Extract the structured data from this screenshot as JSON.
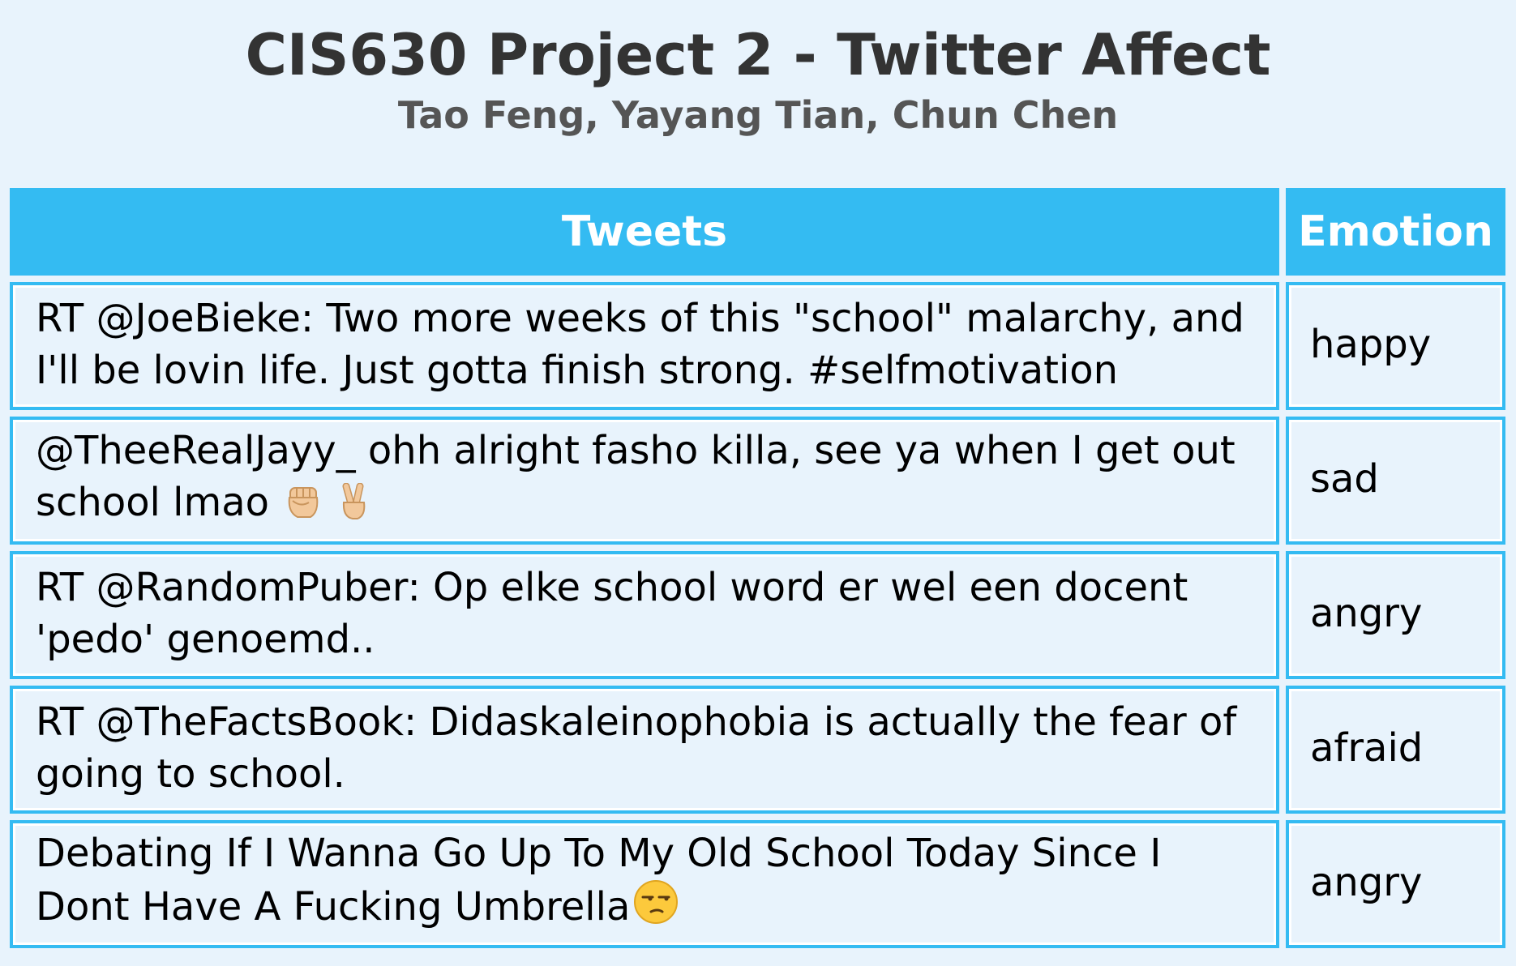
{
  "header": {
    "title": "CIS630 Project 2 - Twitter Affect",
    "subtitle": "Tao Feng, Yayang Tian, Chun Chen"
  },
  "table": {
    "columns": [
      "Tweets",
      "Emotion"
    ],
    "rows": [
      {
        "tweet": "RT @JoeBieke: Two more weeks of this \"school\" malarchy, and I'll be lovin life. Just gotta finish strong. #selfmotivation",
        "emotion": "happy"
      },
      {
        "tweet": "@TheeRealJayy_ ohh alright fasho killa, see ya when I get out school lmao",
        "emoji": [
          "raised-fist-icon",
          "victory-hand-icon"
        ],
        "emotion": "sad"
      },
      {
        "tweet": "RT @RandomPuber: Op elke school word er wel een docent 'pedo' genoemd..",
        "emotion": "angry"
      },
      {
        "tweet": "RT @TheFactsBook: Didaskaleinophobia is actually the fear of going to school.",
        "emotion": "afraid"
      },
      {
        "tweet": "Debating If I Wanna Go Up To My Old School Today Since I Dont Have A Fucking Umbrella",
        "emoji": [
          "unamused-face-icon"
        ],
        "emotion": "angry"
      }
    ]
  },
  "colors": {
    "background": "#e8f3fc",
    "accent": "#34bbf2",
    "title": "#333333",
    "subtitle": "#555555"
  }
}
